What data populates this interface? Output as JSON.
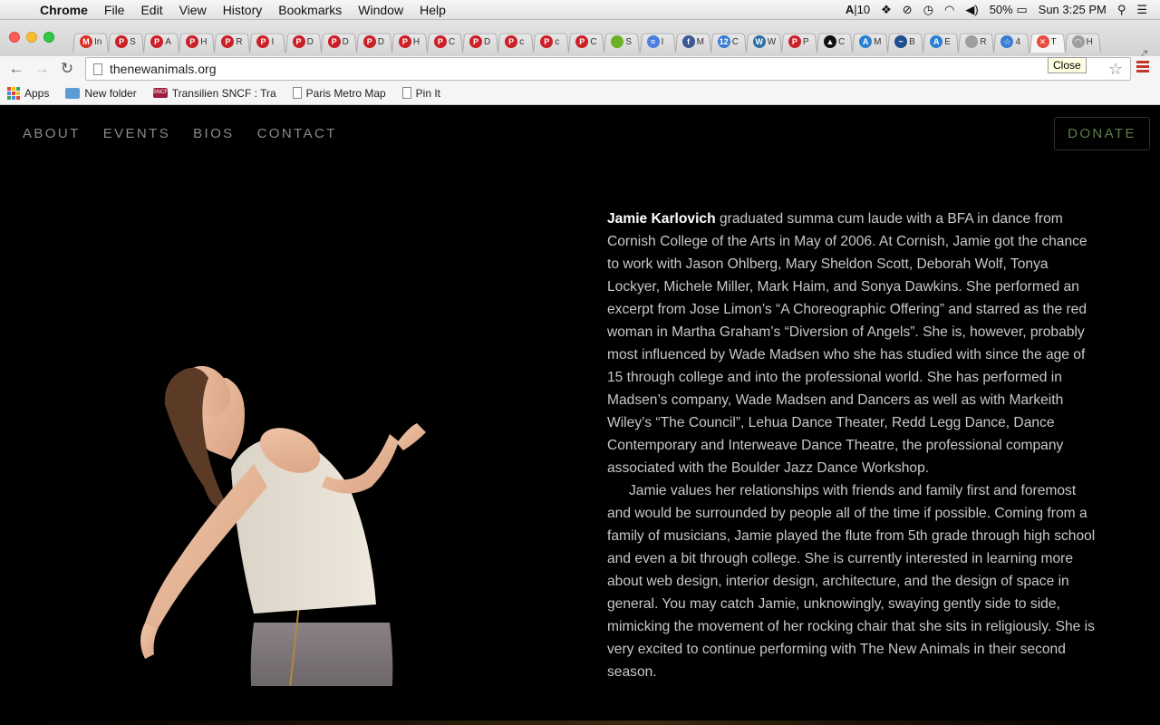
{
  "menubar": {
    "app_name": "Chrome",
    "items": [
      "File",
      "Edit",
      "View",
      "History",
      "Bookmarks",
      "Window",
      "Help"
    ],
    "status": {
      "adobe_count": "10",
      "battery": "50%",
      "clock": "Sun 3:25 PM"
    }
  },
  "tabs": [
    {
      "icon": "gmail-icon",
      "label": "In",
      "color": "#d93025",
      "glyph": "M"
    },
    {
      "icon": "pinterest-icon",
      "label": "S",
      "color": "#cb2027",
      "glyph": "P"
    },
    {
      "icon": "pinterest-icon",
      "label": "A",
      "color": "#cb2027",
      "glyph": "P"
    },
    {
      "icon": "pinterest-icon",
      "label": "H",
      "color": "#cb2027",
      "glyph": "P"
    },
    {
      "icon": "pinterest-icon",
      "label": "R",
      "color": "#cb2027",
      "glyph": "P"
    },
    {
      "icon": "pinterest-icon",
      "label": "I",
      "color": "#cb2027",
      "glyph": "P"
    },
    {
      "icon": "pinterest-icon",
      "label": "D",
      "color": "#cb2027",
      "glyph": "P"
    },
    {
      "icon": "pinterest-icon",
      "label": "D",
      "color": "#cb2027",
      "glyph": "P"
    },
    {
      "icon": "pinterest-icon",
      "label": "D",
      "color": "#cb2027",
      "glyph": "P"
    },
    {
      "icon": "pinterest-icon",
      "label": "H",
      "color": "#cb2027",
      "glyph": "P"
    },
    {
      "icon": "pinterest-icon",
      "label": "C",
      "color": "#cb2027",
      "glyph": "P"
    },
    {
      "icon": "pinterest-icon",
      "label": "D",
      "color": "#cb2027",
      "glyph": "P"
    },
    {
      "icon": "pinterest-icon",
      "label": "c",
      "color": "#cb2027",
      "glyph": "P"
    },
    {
      "icon": "pinterest-icon",
      "label": "c",
      "color": "#cb2027",
      "glyph": "P"
    },
    {
      "icon": "pinterest-icon",
      "label": "C",
      "color": "#cb2027",
      "glyph": "P"
    },
    {
      "icon": "green-circle-icon",
      "label": "S",
      "color": "#6ab023",
      "glyph": ""
    },
    {
      "icon": "docs-icon",
      "label": "I",
      "color": "#4a7fe0",
      "glyph": "≡"
    },
    {
      "icon": "facebook-icon",
      "label": "M",
      "color": "#3b5998",
      "glyph": "f"
    },
    {
      "icon": "calendar-icon",
      "label": "C",
      "color": "#3a7bd5",
      "glyph": "12"
    },
    {
      "icon": "wordpress-icon",
      "label": "W",
      "color": "#2f6fa6",
      "glyph": "W"
    },
    {
      "icon": "pinterest-icon",
      "label": "P",
      "color": "#cb2027",
      "glyph": "P"
    },
    {
      "icon": "black-square-icon",
      "label": "C",
      "color": "#111111",
      "glyph": "▲"
    },
    {
      "icon": "a-logo-icon",
      "label": "M",
      "color": "#2a7fd4",
      "glyph": "A"
    },
    {
      "icon": "wave-icon",
      "label": "B",
      "color": "#1f4f8f",
      "glyph": "~"
    },
    {
      "icon": "a-logo-icon",
      "label": "E",
      "color": "#2a7fd4",
      "glyph": "A"
    },
    {
      "icon": "page-icon",
      "label": "R",
      "color": "#9e9e9e",
      "glyph": ""
    },
    {
      "icon": "star-icon",
      "label": "4",
      "color": "#3a7bd5",
      "glyph": "☆"
    },
    {
      "icon": "close-icon",
      "label": "T",
      "color": "#e64c3c",
      "glyph": "✕",
      "active": true
    },
    {
      "icon": "loading-icon",
      "label": "H",
      "color": "#9e9e9e",
      "glyph": "◠"
    }
  ],
  "toolbar": {
    "url": "thenewanimals.org",
    "tooltip": "Close"
  },
  "bookmarks": [
    {
      "icon": "apps-icon",
      "label": "Apps"
    },
    {
      "icon": "folder-icon",
      "label": "New folder"
    },
    {
      "icon": "sncf-icon",
      "label": "Transilien SNCF : Tra"
    },
    {
      "icon": "page-icon",
      "label": "Paris Metro Map"
    },
    {
      "icon": "page-icon",
      "label": "Pin It"
    }
  ],
  "site": {
    "nav": [
      "ABOUT",
      "EVENTS",
      "BIOS",
      "CONTACT"
    ],
    "donate": "DONATE",
    "bio_name": "Jamie Karlovich",
    "bio_p1": " graduated summa cum laude with a BFA in dance from Cornish College of the Arts in May of 2006. At Cornish, Jamie got the chance to work with Jason Ohlberg, Mary Sheldon Scott, Deborah Wolf, Tonya Lockyer, Michele Miller, Mark Haim, and Sonya Dawkins. She performed an excerpt from Jose Limon’s “A Choreographic Offering” and starred as the red woman in Martha Graham’s “Diversion of Angels”. She is, however, probably most influenced by Wade Madsen who she has studied with since the age of 15 through college and into the professional world. She has performed in Madsen’s company, Wade Madsen and Dancers as well as with Markeith Wiley’s “The Council”, Lehua Dance Theater, Redd Legg Dance, Dance Contemporary and Interweave Dance Theatre, the professional company associated with the Boulder Jazz Dance Workshop.",
    "bio_p2": "Jamie values her relationships with friends and family first and foremost and would be surrounded by people all of the time if possible. Coming from a family of musicians, Jamie played the flute from 5th grade through high school and even a bit through college. She is currently interested in learning more about web design, interior design, architecture, and the design of space in general. You may catch Jamie, unknowingly, swaying gently side to side, mimicking the movement of her rocking chair that she sits in religiously. She is very excited to continue performing with The New Animals in their second season."
  }
}
